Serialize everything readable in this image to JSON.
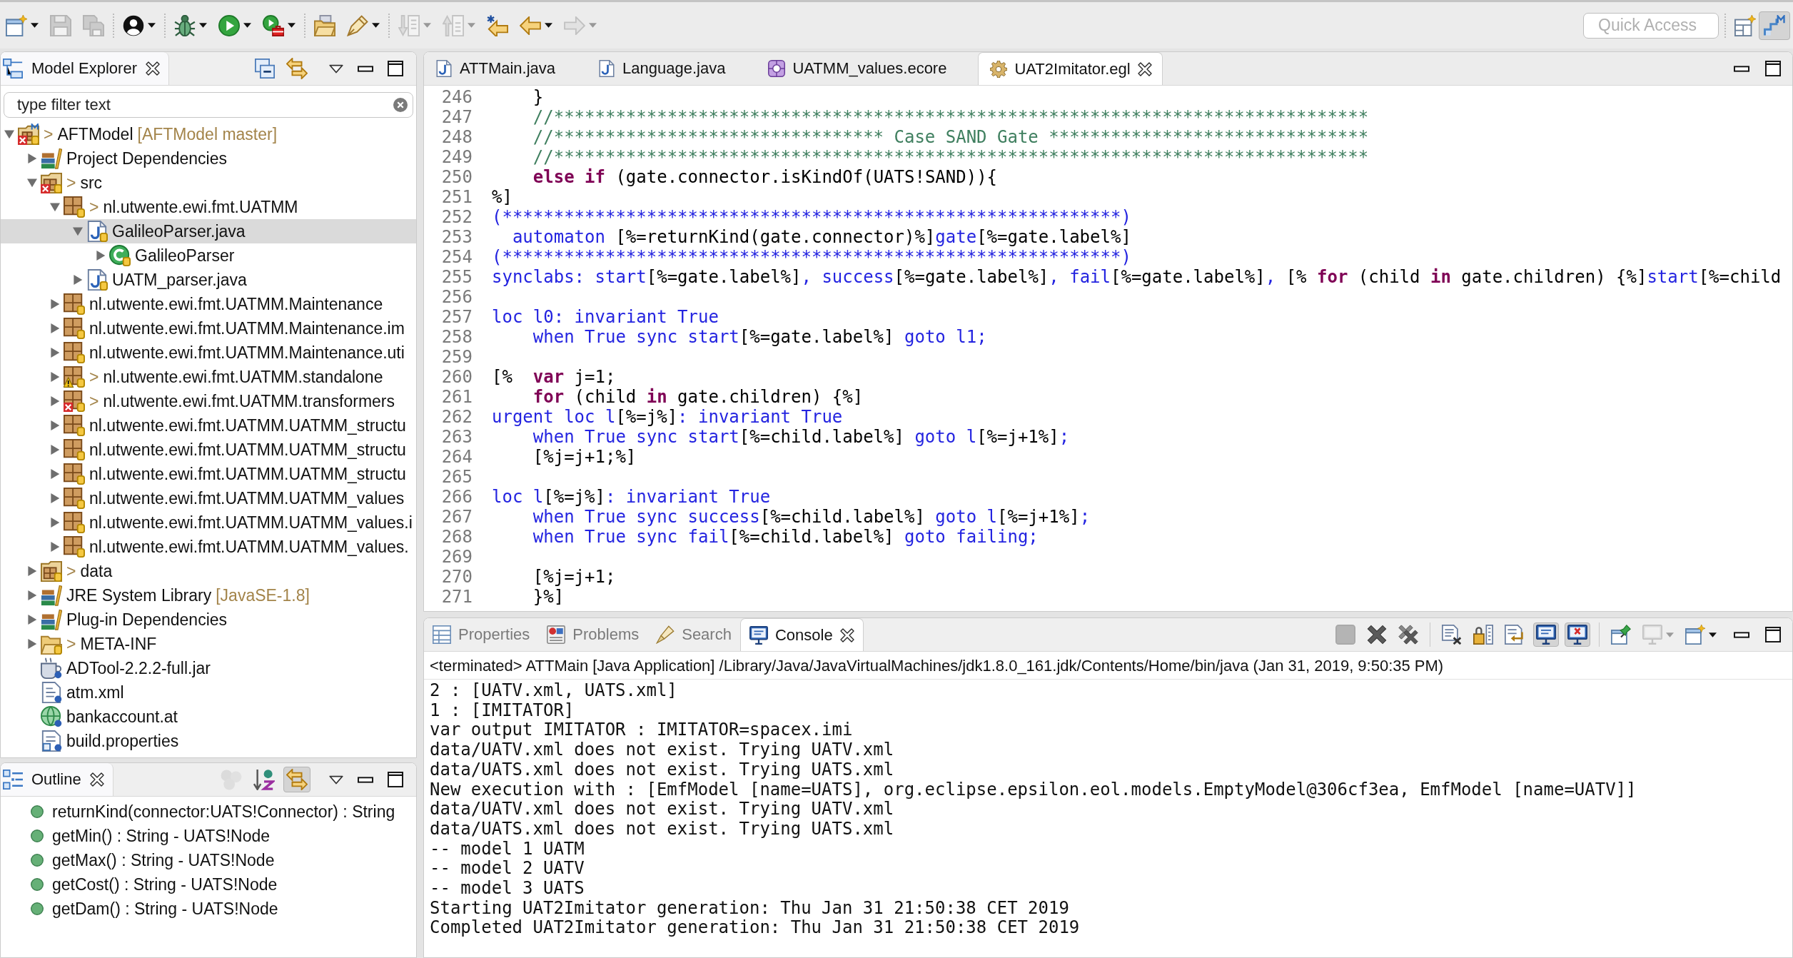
{
  "toolbar": {
    "groups": [
      [
        {
          "dropdown": true,
          "disabled": false
        },
        {
          "dropdown": false,
          "disabled": true
        },
        {
          "dropdown": false,
          "disabled": true
        }
      ],
      [
        {
          "dropdown": true,
          "disabled": false
        }
      ],
      [
        {
          "dropdown": true,
          "disabled": false
        },
        {
          "dropdown": true,
          "disabled": false
        },
        {
          "dropdown": true,
          "disabled": false
        }
      ],
      [
        {
          "dropdown": false,
          "disabled": false
        },
        {
          "dropdown": true,
          "disabled": false
        }
      ],
      [
        {
          "dropdown": true,
          "disabled": true
        },
        {
          "dropdown": true,
          "disabled": true
        },
        {
          "dropdown": false,
          "disabled": false
        },
        {
          "dropdown": true,
          "disabled": false
        },
        {
          "dropdown": true,
          "disabled": true
        }
      ]
    ],
    "quick_access": {
      "placeholder": "Quick Access"
    },
    "perspectives": [
      {
        "selected": true
      }
    ]
  },
  "model_explorer": {
    "title": "Model Explorer",
    "filter": {
      "placeholder": "type filter text"
    },
    "tree": [
      {
        "label": "AFTModel",
        "prefix": ">",
        "decoration": "[AFTModel master]",
        "kind": "project",
        "error": true,
        "warning": false,
        "selected": false,
        "expanded": true,
        "children": [
          {
            "label": "Project Dependencies",
            "kind": "library",
            "error": false,
            "warning": false,
            "selected": false,
            "expanded": false
          },
          {
            "label": "src",
            "prefix": ">",
            "kind": "source",
            "error": true,
            "warning": false,
            "selected": false,
            "expanded": true,
            "children": [
              {
                "label": "nl.utwente.ewi.fmt.UATMM",
                "prefix": ">",
                "kind": "package",
                "error": false,
                "warning": false,
                "selected": false,
                "expanded": true,
                "children": [
                  {
                    "label": "GalileoParser.java",
                    "kind": "java",
                    "error": false,
                    "warning": false,
                    "selected": true,
                    "expanded": true,
                    "children": [
                      {
                        "label": "GalileoParser",
                        "kind": "class",
                        "error": false,
                        "warning": false,
                        "selected": false,
                        "expanded": false
                      }
                    ]
                  },
                  {
                    "label": "UATM_parser.java",
                    "kind": "java",
                    "error": false,
                    "warning": false,
                    "selected": false,
                    "expanded": false
                  }
                ]
              },
              {
                "label": "nl.utwente.ewi.fmt.UATMM.Maintenance",
                "kind": "package",
                "error": false,
                "warning": false,
                "selected": false,
                "expanded": false
              },
              {
                "label": "nl.utwente.ewi.fmt.UATMM.Maintenance.im",
                "kind": "package",
                "error": false,
                "warning": false,
                "selected": false,
                "expanded": false
              },
              {
                "label": "nl.utwente.ewi.fmt.UATMM.Maintenance.uti",
                "kind": "package",
                "error": false,
                "warning": false,
                "selected": false,
                "expanded": false
              },
              {
                "label": "nl.utwente.ewi.fmt.UATMM.standalone",
                "prefix": ">",
                "kind": "package",
                "error": false,
                "warning": true,
                "selected": false,
                "expanded": false
              },
              {
                "label": "nl.utwente.ewi.fmt.UATMM.transformers",
                "prefix": ">",
                "kind": "package",
                "error": true,
                "warning": false,
                "selected": false,
                "expanded": false
              },
              {
                "label": "nl.utwente.ewi.fmt.UATMM.UATMM_structu",
                "kind": "package",
                "error": false,
                "warning": false,
                "selected": false,
                "expanded": false
              },
              {
                "label": "nl.utwente.ewi.fmt.UATMM.UATMM_structu",
                "kind": "package",
                "error": false,
                "warning": false,
                "selected": false,
                "expanded": false
              },
              {
                "label": "nl.utwente.ewi.fmt.UATMM.UATMM_structu",
                "kind": "package",
                "error": false,
                "warning": false,
                "selected": false,
                "expanded": false
              },
              {
                "label": "nl.utwente.ewi.fmt.UATMM.UATMM_values",
                "kind": "package",
                "error": false,
                "warning": false,
                "selected": false,
                "expanded": false
              },
              {
                "label": "nl.utwente.ewi.fmt.UATMM.UATMM_values.i",
                "kind": "package",
                "error": false,
                "warning": false,
                "selected": false,
                "expanded": false
              },
              {
                "label": "nl.utwente.ewi.fmt.UATMM.UATMM_values.",
                "kind": "package",
                "error": false,
                "warning": false,
                "selected": false,
                "expanded": false
              }
            ]
          },
          {
            "label": "data",
            "prefix": ">",
            "kind": "source",
            "error": false,
            "warning": false,
            "selected": false,
            "expanded": false
          },
          {
            "label": "JRE System Library",
            "decoration": "[JavaSE-1.8]",
            "kind": "library",
            "error": false,
            "warning": false,
            "selected": false,
            "expanded": false
          },
          {
            "label": "Plug-in Dependencies",
            "kind": "library",
            "error": false,
            "warning": false,
            "selected": false,
            "expanded": false
          },
          {
            "label": "META-INF",
            "prefix": ">",
            "kind": "folder",
            "error": false,
            "warning": false,
            "selected": false,
            "expanded": false
          },
          {
            "label": "ADTool-2.2.2-full.jar",
            "kind": "jar",
            "error": false,
            "warning": false,
            "selected": false
          },
          {
            "label": "atm.xml",
            "kind": "xml",
            "error": false,
            "warning": false,
            "selected": false
          },
          {
            "label": "bankaccount.at",
            "kind": "at",
            "error": false,
            "warning": false,
            "selected": false
          },
          {
            "label": "build.properties",
            "kind": "properties",
            "error": false,
            "warning": false,
            "selected": false
          }
        ]
      }
    ]
  },
  "outline": {
    "title": "Outline",
    "toolbar": [
      {
        "disabled": true,
        "on": false
      },
      {
        "disabled": false,
        "on": false
      },
      {
        "disabled": false,
        "on": true
      }
    ],
    "items": [
      {
        "label": "returnKind(connector:UATS!Connector) : String"
      },
      {
        "label": "getMin() : String - UATS!Node"
      },
      {
        "label": "getMax() : String - UATS!Node"
      },
      {
        "label": "getCost() : String - UATS!Node"
      },
      {
        "label": "getDam() : String - UATS!Node"
      }
    ]
  },
  "editor": {
    "tabs": [
      {
        "label": "ATTMain.java",
        "kind": "java",
        "selected": false
      },
      {
        "label": "Language.java",
        "kind": "java",
        "selected": false
      },
      {
        "label": "UATMM_values.ecore",
        "kind": "ecore",
        "selected": false
      },
      {
        "label": "UAT2Imitator.egl",
        "kind": "egl",
        "selected": true
      }
    ],
    "lines": [
      {
        "number": "246",
        "segments": [
          {
            "kind": "plain",
            "text": "    }"
          }
        ]
      },
      {
        "number": "247",
        "segments": [
          {
            "kind": "comment",
            "text": "    //*******************************************************************************"
          }
        ]
      },
      {
        "number": "248",
        "segments": [
          {
            "kind": "comment",
            "text": "    //******************************** Case SAND Gate *******************************"
          }
        ]
      },
      {
        "number": "249",
        "segments": [
          {
            "kind": "comment",
            "text": "    //*******************************************************************************"
          }
        ]
      },
      {
        "number": "250",
        "segments": [
          {
            "kind": "keyword",
            "text": "    else if"
          },
          {
            "kind": "plain",
            "text": " (gate.connector.isKindOf(UATS!SAND)){"
          }
        ]
      },
      {
        "number": "251",
        "segments": [
          {
            "kind": "plain",
            "text": "%]"
          }
        ]
      },
      {
        "number": "252",
        "segments": [
          {
            "kind": "static",
            "text": "(************************************************************)"
          }
        ]
      },
      {
        "number": "253",
        "segments": [
          {
            "kind": "static",
            "text": "  automaton "
          },
          {
            "kind": "plain",
            "text": "[%=returnKind(gate.connector)%]"
          },
          {
            "kind": "static",
            "text": "gate"
          },
          {
            "kind": "plain",
            "text": "[%=gate.label%]"
          }
        ]
      },
      {
        "number": "254",
        "segments": [
          {
            "kind": "static",
            "text": "(************************************************************)"
          }
        ]
      },
      {
        "number": "255",
        "segments": [
          {
            "kind": "static",
            "text": "synclabs: start"
          },
          {
            "kind": "plain",
            "text": "[%=gate.label%]"
          },
          {
            "kind": "static",
            "text": ", success"
          },
          {
            "kind": "plain",
            "text": "[%=gate.label%]"
          },
          {
            "kind": "static",
            "text": ", fail"
          },
          {
            "kind": "plain",
            "text": "[%=gate.label%]"
          },
          {
            "kind": "static",
            "text": ", "
          },
          {
            "kind": "plain",
            "text": "[% "
          },
          {
            "kind": "keyword",
            "text": "for"
          },
          {
            "kind": "plain",
            "text": " (child "
          },
          {
            "kind": "keyword",
            "text": "in"
          },
          {
            "kind": "plain",
            "text": " gate.children) {%]"
          },
          {
            "kind": "static",
            "text": "start"
          },
          {
            "kind": "plain",
            "text": "[%=child"
          }
        ]
      },
      {
        "number": "256"
      },
      {
        "number": "257",
        "segments": [
          {
            "kind": "static",
            "text": "loc l0: invariant True"
          }
        ]
      },
      {
        "number": "258",
        "segments": [
          {
            "kind": "static",
            "text": "    when True sync start"
          },
          {
            "kind": "plain",
            "text": "[%=gate.label%]"
          },
          {
            "kind": "static",
            "text": " goto l1;"
          }
        ]
      },
      {
        "number": "259"
      },
      {
        "number": "260",
        "segments": [
          {
            "kind": "plain",
            "text": "[%  "
          },
          {
            "kind": "keyword",
            "text": "var"
          },
          {
            "kind": "plain",
            "text": " j=1;"
          }
        ]
      },
      {
        "number": "261",
        "segments": [
          {
            "kind": "keyword",
            "text": "    for"
          },
          {
            "kind": "plain",
            "text": " (child "
          },
          {
            "kind": "keyword",
            "text": "in"
          },
          {
            "kind": "plain",
            "text": " gate.children) {%]"
          }
        ]
      },
      {
        "number": "262",
        "segments": [
          {
            "kind": "static",
            "text": "urgent loc l"
          },
          {
            "kind": "plain",
            "text": "[%=j%]"
          },
          {
            "kind": "static",
            "text": ": invariant True"
          }
        ]
      },
      {
        "number": "263",
        "segments": [
          {
            "kind": "static",
            "text": "    when True sync start"
          },
          {
            "kind": "plain",
            "text": "[%=child.label%]"
          },
          {
            "kind": "static",
            "text": " goto l"
          },
          {
            "kind": "plain",
            "text": "[%=j+1%]"
          },
          {
            "kind": "static",
            "text": ";"
          }
        ]
      },
      {
        "number": "264",
        "segments": [
          {
            "kind": "plain",
            "text": "    [%j=j+1;%]"
          }
        ]
      },
      {
        "number": "265"
      },
      {
        "number": "266",
        "segments": [
          {
            "kind": "static",
            "text": "loc l"
          },
          {
            "kind": "plain",
            "text": "[%=j%]"
          },
          {
            "kind": "static",
            "text": ": invariant True"
          }
        ]
      },
      {
        "number": "267",
        "segments": [
          {
            "kind": "static",
            "text": "    when True sync success"
          },
          {
            "kind": "plain",
            "text": "[%=child.label%]"
          },
          {
            "kind": "static",
            "text": " goto l"
          },
          {
            "kind": "plain",
            "text": "[%=j+1%]"
          },
          {
            "kind": "static",
            "text": ";"
          }
        ]
      },
      {
        "number": "268",
        "segments": [
          {
            "kind": "static",
            "text": "    when True sync fail"
          },
          {
            "kind": "plain",
            "text": "[%=child.label%]"
          },
          {
            "kind": "static",
            "text": " goto failing;"
          }
        ]
      },
      {
        "number": "269"
      },
      {
        "number": "270",
        "segments": [
          {
            "kind": "plain",
            "text": "    [%j=j+1;"
          }
        ]
      },
      {
        "number": "271",
        "segments": [
          {
            "kind": "plain",
            "text": "    }%]"
          }
        ]
      }
    ]
  },
  "console_view": {
    "tabs": [
      {
        "label": "Properties",
        "selected": false
      },
      {
        "label": "Problems",
        "selected": false
      },
      {
        "label": "Search",
        "selected": false
      },
      {
        "label": "Console",
        "selected": true
      }
    ],
    "toolbar": {
      "groups": [
        [
          {
            "disabled": true,
            "on": false,
            "dropdown": false
          },
          {
            "disabled": false,
            "on": false,
            "dropdown": false
          },
          {
            "disabled": false,
            "on": false,
            "dropdown": false
          }
        ],
        [
          {
            "disabled": false,
            "on": false,
            "dropdown": false
          },
          {
            "disabled": false,
            "on": false,
            "dropdown": false
          },
          {
            "disabled": false,
            "on": false,
            "dropdown": false
          },
          {
            "disabled": false,
            "on": true,
            "dropdown": false
          },
          {
            "disabled": false,
            "on": true,
            "dropdown": false
          }
        ],
        [
          {
            "disabled": false,
            "on": false,
            "dropdown": false
          },
          {
            "disabled": true,
            "on": false,
            "dropdown": true
          },
          {
            "disabled": false,
            "on": false,
            "dropdown": true
          }
        ]
      ]
    },
    "status": "<terminated> ATTMain [Java Application] /Library/Java/JavaVirtualMachines/jdk1.8.0_161.jdk/Contents/Home/bin/java (Jan 31, 2019, 9:50:35 PM)",
    "lines": [
      "2 : [UATV.xml, UATS.xml]",
      "1 : [IMITATOR]",
      "var output IMITATOR : IMITATOR=spacex.imi",
      "data/UATV.xml does not exist. Trying UATV.xml",
      "data/UATS.xml does not exist. Trying UATS.xml",
      "New execution with : [EmfModel [name=UATS], org.eclipse.epsilon.eol.models.EmptyModel@306cf3ea, EmfModel [name=UATV]]",
      "data/UATV.xml does not exist. Trying UATV.xml",
      "data/UATS.xml does not exist. Trying UATS.xml",
      "-- model 1 UATM",
      "-- model 2 UATV",
      "-- model 3 UATS",
      "Starting UAT2Imitator generation: Thu Jan 31 21:50:38 CET 2019",
      "Completed UAT2Imitator generation: Thu Jan 31 21:50:38 CET 2019"
    ]
  }
}
